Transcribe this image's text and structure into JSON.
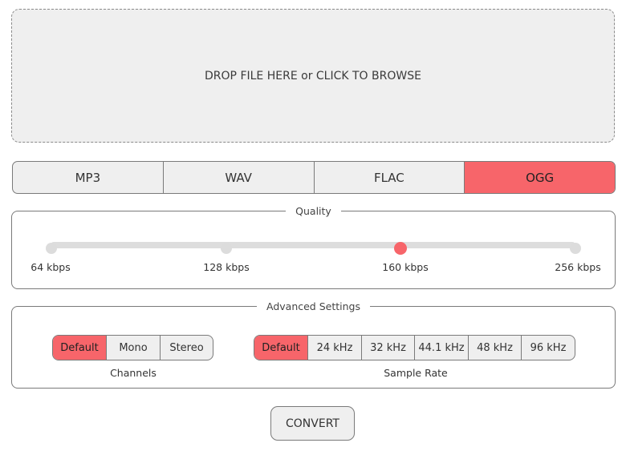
{
  "dropzone": {
    "label": "DROP FILE HERE or CLICK TO BROWSE"
  },
  "formats": {
    "items": [
      "MP3",
      "WAV",
      "FLAC",
      "OGG"
    ],
    "selected": "OGG"
  },
  "quality": {
    "legend": "Quality",
    "stops": [
      "64 kbps",
      "128 kbps",
      "160 kbps",
      "256 kbps"
    ],
    "selected": "160 kbps"
  },
  "advanced": {
    "legend": "Advanced Settings",
    "channels": {
      "caption": "Channels",
      "options": [
        "Default",
        "Mono",
        "Stereo"
      ],
      "selected": "Default"
    },
    "sample_rate": {
      "caption": "Sample Rate",
      "options": [
        "Default",
        "24 kHz",
        "32 kHz",
        "44.1 kHz",
        "48 kHz",
        "96 kHz"
      ],
      "selected": "Default"
    }
  },
  "convert": {
    "label": "CONVERT"
  },
  "colors": {
    "accent": "#f7656a",
    "surface": "#efefef",
    "border": "#7a7a7a",
    "track": "#dddddd"
  }
}
